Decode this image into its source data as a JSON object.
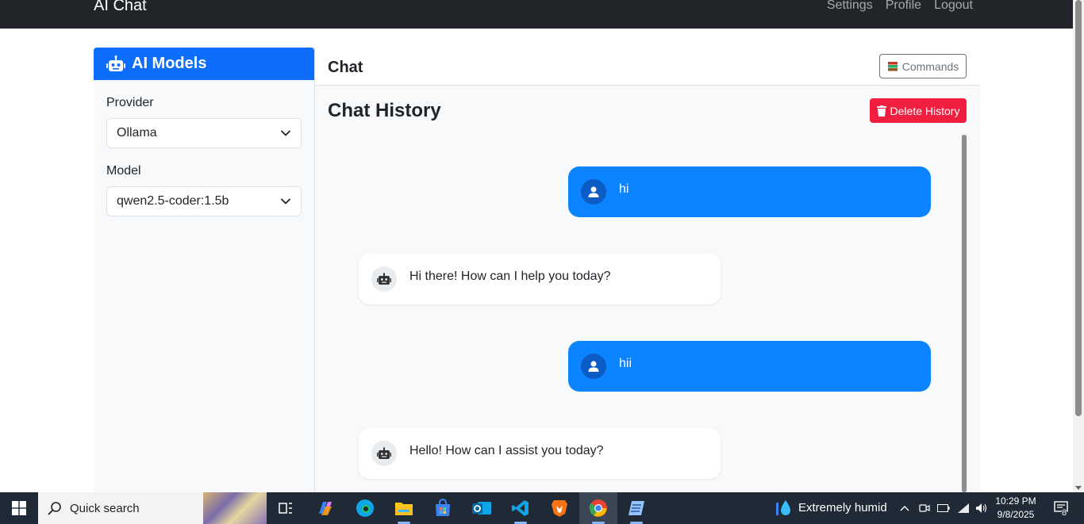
{
  "navbar": {
    "brand": "AI Chat",
    "links": [
      "Settings",
      "Profile",
      "Logout"
    ]
  },
  "sidebar": {
    "title": "AI Models",
    "provider_label": "Provider",
    "provider_value": "Ollama",
    "model_label": "Model",
    "model_value": "qwen2.5-coder:1.5b"
  },
  "chat": {
    "title": "Chat",
    "commands_label": "Commands",
    "history_title": "Chat History",
    "delete_label": "Delete History",
    "messages": [
      {
        "role": "user",
        "text": "hi"
      },
      {
        "role": "bot",
        "text": "Hi there! How can I help you today?"
      },
      {
        "role": "user",
        "text": "hii"
      },
      {
        "role": "bot",
        "text": "Hello! How can I assist you today?"
      }
    ]
  },
  "taskbar": {
    "search_label": "Quick search",
    "weather": "Extremely humid",
    "time": "10:29 PM",
    "date": "9/8/2025",
    "notification_count": "8",
    "apps": [
      "task-view-icon",
      "copilot-icon",
      "edge-icon",
      "file-explorer-icon",
      "store-icon",
      "outlook-icon",
      "vscode-icon",
      "brave-icon",
      "chrome-icon",
      "notepad-icon"
    ]
  },
  "colors": {
    "primary": "#0d6efd",
    "user_bubble": "#0d84ff",
    "danger": "#f01f3f",
    "navbar": "#212529"
  }
}
